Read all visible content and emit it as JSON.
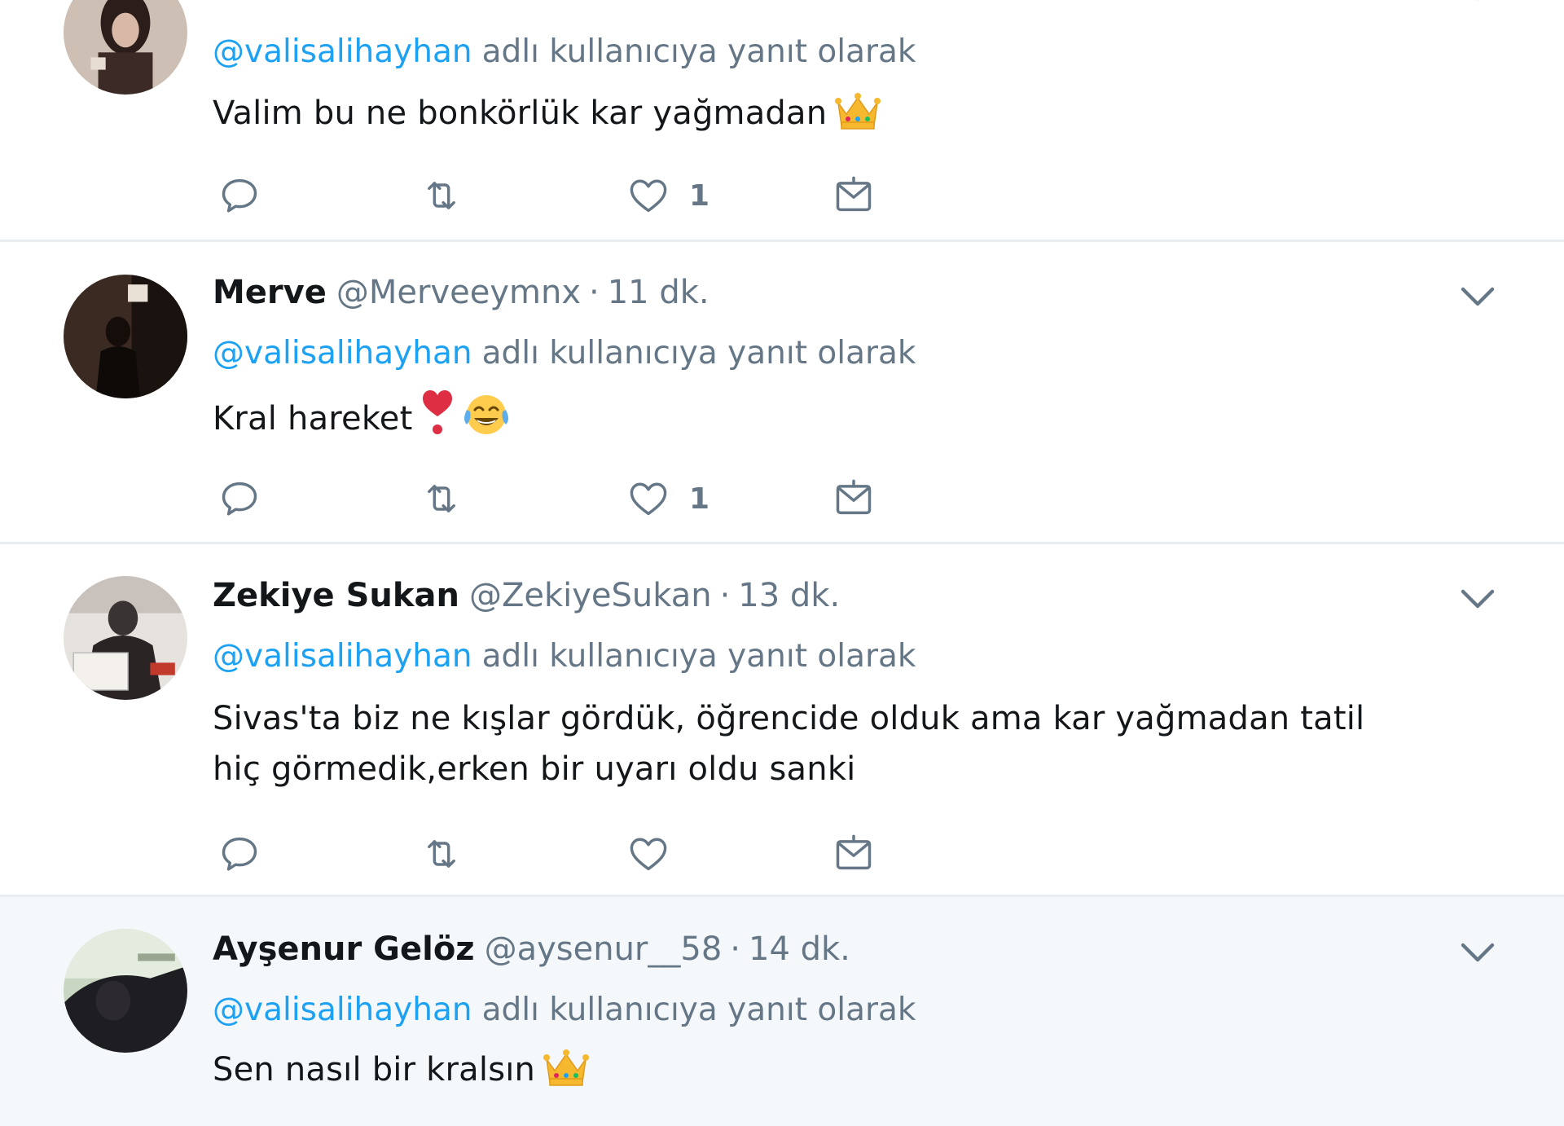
{
  "tweets": [
    {
      "fullname": "",
      "screen_name": "",
      "time": "",
      "reply_mention": "@valisalihayhan",
      "reply_suffix": "adlı kullanıcıya yanıt olarak",
      "text": "Valim bu ne bonkörlük kar yağmadan",
      "emojis": [
        "crown-emoji"
      ],
      "like_count": "1",
      "avatar_colors": [
        "#cdbfb4",
        "#2a1d1a"
      ]
    },
    {
      "fullname": "Merve",
      "screen_name": "@Merveeymnx",
      "separator": "·",
      "time": "11 dk.",
      "reply_mention": "@valisalihayhan",
      "reply_suffix": "adlı kullanıcıya yanıt olarak",
      "text": "Kral hareket",
      "emojis": [
        "heavy-heart-exclamation-emoji",
        "tears-of-joy-emoji"
      ],
      "like_count": "1",
      "avatar_colors": [
        "#3b2a22",
        "#0d0a08"
      ]
    },
    {
      "fullname": "Zekiye Sukan",
      "screen_name": "@ZekiyeSukan",
      "separator": "·",
      "time": "13 dk.",
      "reply_mention": "@valisalihayhan",
      "reply_suffix": "adlı kullanıcıya yanıt olarak",
      "text": "Sivas'ta biz ne kışlar gördük, öğrencide olduk ama kar yağmadan tatil hiç görmedik,erken bir uyarı oldu sanki",
      "emojis": [],
      "like_count": "",
      "avatar_colors": [
        "#e6e2de",
        "#3a3333"
      ]
    },
    {
      "fullname": "Ayşenur Gelöz",
      "screen_name": "@aysenur__58",
      "separator": "·",
      "time": "14 dk.",
      "reply_mention": "@valisalihayhan",
      "reply_suffix": "adlı kullanıcıya yanıt olarak",
      "text": "Sen nasıl bir kralsın",
      "emojis": [
        "crown-emoji"
      ],
      "like_count": "",
      "avatar_colors": [
        "#c9d6c2",
        "#1e1e22"
      ]
    }
  ],
  "colors": {
    "link": "#1da1f2",
    "secondary_text": "#657786",
    "primary_text": "#14171a",
    "divider": "#e6ecf0",
    "hover_bg": "#f5f8fa"
  }
}
